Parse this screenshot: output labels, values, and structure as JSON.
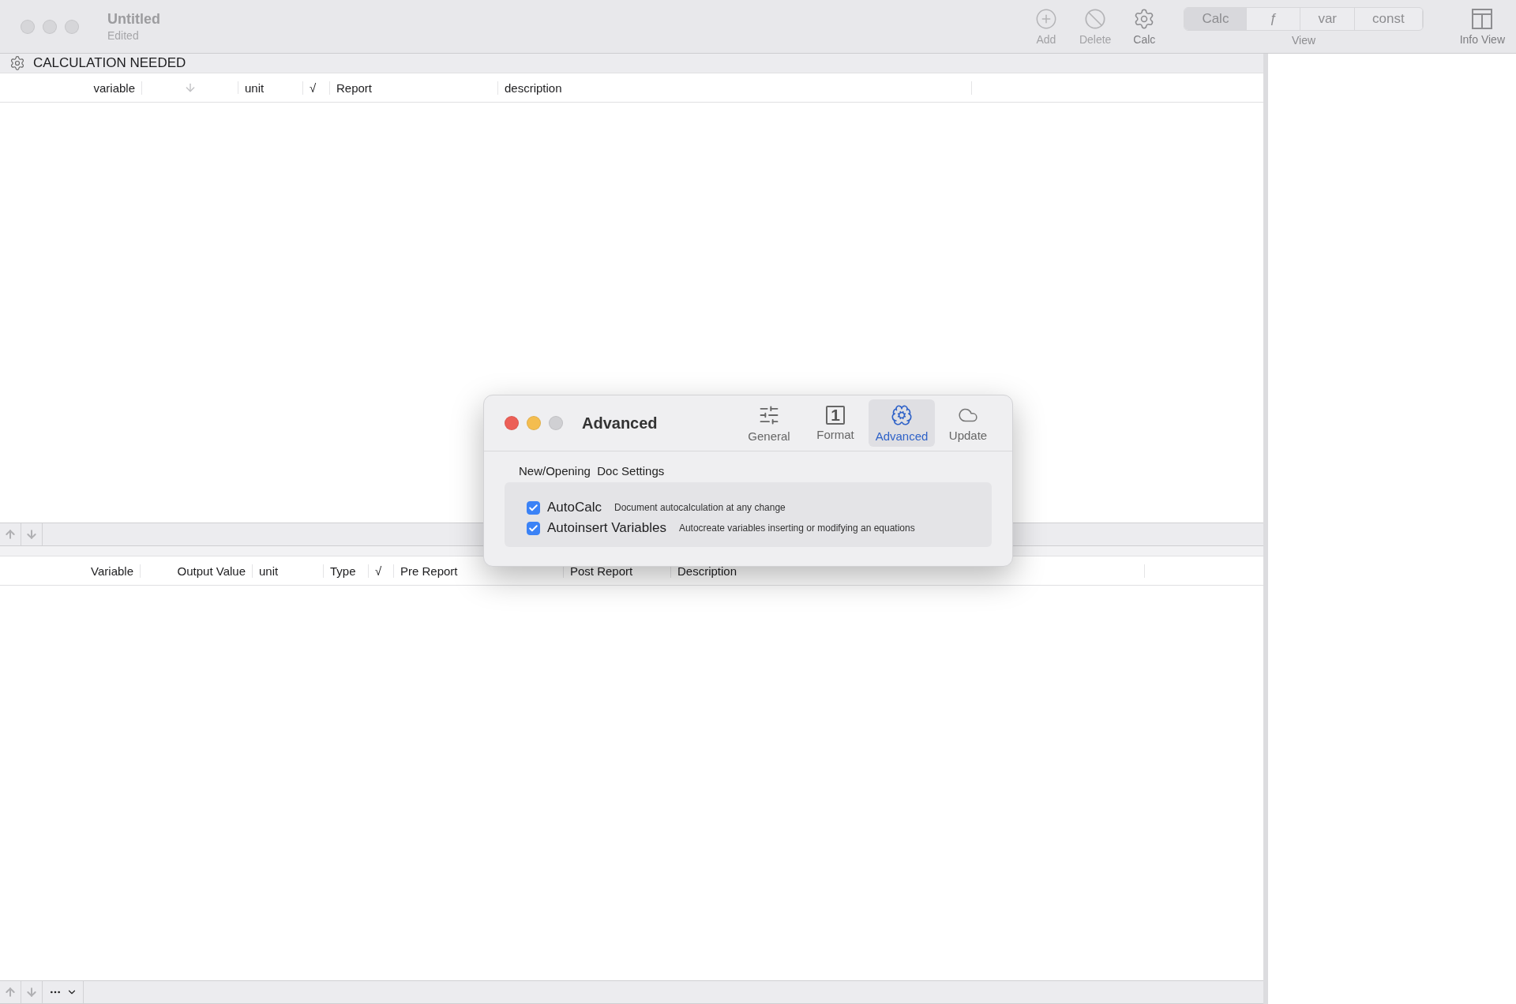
{
  "window": {
    "title": "Untitled",
    "subtitle": "Edited"
  },
  "toolbar": [
    {
      "kind": "add",
      "label": "Add",
      "disabled": true
    },
    {
      "kind": "delete",
      "label": "Delete",
      "disabled": true
    },
    {
      "kind": "calc",
      "label": "Calc",
      "disabled": false
    },
    {
      "kind": "view",
      "label": "View",
      "segments": [
        {
          "label": "Calc",
          "selected": true
        },
        {
          "label": "ƒ",
          "selected": false
        },
        {
          "label": "var",
          "selected": false
        },
        {
          "label": "const",
          "selected": false
        }
      ]
    },
    {
      "kind": "info",
      "label": "Info View",
      "disabled": false
    }
  ],
  "status": {
    "text": "CALCULATION NEEDED"
  },
  "equations_table": {
    "columns": [
      {
        "kind": "text",
        "label": "variable"
      },
      {
        "kind": "sort"
      },
      {
        "kind": "text",
        "label": "unit"
      },
      {
        "kind": "text",
        "label": "√"
      },
      {
        "kind": "text",
        "label": "Report"
      },
      {
        "kind": "text",
        "label": "description"
      }
    ]
  },
  "results_table": {
    "columns": [
      {
        "kind": "text",
        "label": "Variable"
      },
      {
        "kind": "text",
        "label": "Output Value"
      },
      {
        "kind": "text",
        "label": "unit"
      },
      {
        "kind": "text",
        "label": "Type"
      },
      {
        "kind": "text",
        "label": "√"
      },
      {
        "kind": "text",
        "label": "Pre Report"
      },
      {
        "kind": "text",
        "label": "Post Report"
      },
      {
        "kind": "text",
        "label": "Description"
      }
    ]
  },
  "dialog": {
    "title": "Advanced",
    "tabs": [
      {
        "kind": "general",
        "label": "General",
        "selected": false
      },
      {
        "kind": "format",
        "label": "Format",
        "badge": "1",
        "selected": false
      },
      {
        "kind": "advanced",
        "label": "Advanced",
        "selected": true
      },
      {
        "kind": "update",
        "label": "Update",
        "selected": false
      }
    ],
    "section_label": "New/Opening  Doc Settings",
    "options": [
      {
        "label": "AutoCalc",
        "description": "Document autocalculation at any change",
        "checked": true
      },
      {
        "label": "Autoinsert Variables",
        "description": "Autocreate variables inserting or modifying an equations",
        "checked": true
      }
    ]
  }
}
